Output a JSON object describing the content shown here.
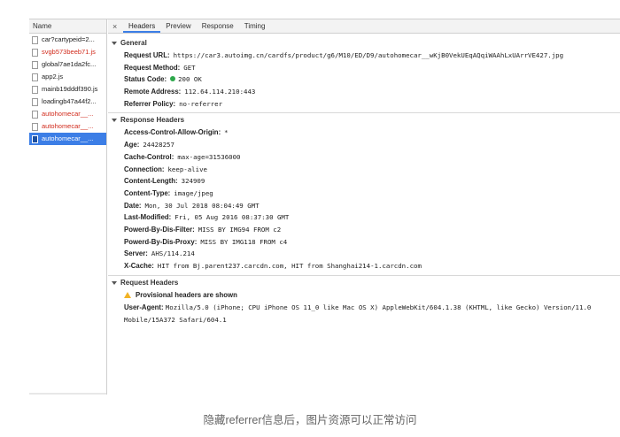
{
  "filelist": {
    "header": "Name",
    "items": [
      {
        "label": "car?cartypeid=2...",
        "red": false
      },
      {
        "label": "svgb573beeb71.js",
        "red": true
      },
      {
        "label": "global7ae1da2fc...",
        "red": false
      },
      {
        "label": "app2.js",
        "red": false
      },
      {
        "label": "mainb19dddf390.js",
        "red": false
      },
      {
        "label": "loadingb47a44f2...",
        "red": false
      },
      {
        "label": "autohomecar__...",
        "red": true
      },
      {
        "label": "autohomecar__...",
        "red": true
      },
      {
        "label": "autohomecar__...",
        "red": false,
        "selected": true
      }
    ]
  },
  "tabs": {
    "close": "×",
    "items": [
      "Headers",
      "Preview",
      "Response",
      "Timing"
    ]
  },
  "general": {
    "title": "General",
    "rows": [
      {
        "k": "Request URL:",
        "v": "https://car3.autoimg.cn/cardfs/product/g6/M10/ED/D9/autohomecar__wKjB0VekUEqAQqiWAAhLxUArrVE427.jpg"
      },
      {
        "k": "Request Method:",
        "v": "GET"
      },
      {
        "k": "Status Code:",
        "v": "200 OK"
      },
      {
        "k": "Remote Address:",
        "v": "112.64.114.210:443"
      },
      {
        "k": "Referrer Policy:",
        "v": "no-referrer"
      }
    ]
  },
  "response_headers": {
    "title": "Response Headers",
    "rows": [
      {
        "k": "Access-Control-Allow-Origin:",
        "v": "*"
      },
      {
        "k": "Age:",
        "v": "24428257"
      },
      {
        "k": "Cache-Control:",
        "v": "max-age=31536000"
      },
      {
        "k": "Connection:",
        "v": "keep-alive"
      },
      {
        "k": "Content-Length:",
        "v": "324909"
      },
      {
        "k": "Content-Type:",
        "v": "image/jpeg"
      },
      {
        "k": "Date:",
        "v": "Mon, 30 Jul 2018 08:04:49 GMT"
      },
      {
        "k": "Last-Modified:",
        "v": "Fri, 05 Aug 2016 08:37:30 GMT"
      },
      {
        "k": "Powerd-By-Dis-Filter:",
        "v": "MISS BY IMG94 FROM c2"
      },
      {
        "k": "Powerd-By-Dis-Proxy:",
        "v": "MISS BY IMG118 FROM c4"
      },
      {
        "k": "Server:",
        "v": "AHS/114.214"
      },
      {
        "k": "X-Cache:",
        "v": "HIT from Bj.parent237.carcdn.com, HIT from Shanghai214-1.carcdn.com"
      }
    ]
  },
  "request_headers": {
    "title": "Request Headers",
    "warning": "Provisional headers are shown",
    "ua_key": "User-Agent:",
    "ua_value": "Mozilla/5.0 (iPhone; CPU iPhone OS 11_0 like Mac OS X) AppleWebKit/604.1.38 (KHTML, like Gecko) Version/11.0 Mobile/15A372 Safari/604.1"
  },
  "caption": "隐藏referrer信息后，图片资源可以正常访问",
  "colors": {
    "selected": "#3c7ee6",
    "error_text": "#d12b1c",
    "status_ok": "#2ea84c",
    "warning": "#f2b325"
  }
}
